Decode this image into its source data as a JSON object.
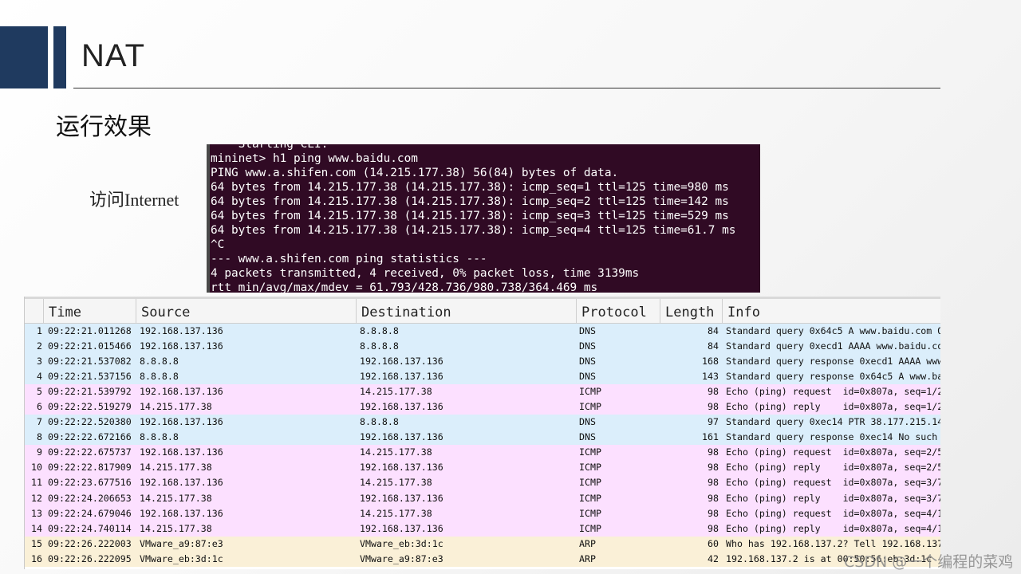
{
  "slide": {
    "title": "NAT",
    "subtitle": "运行效果",
    "side_label": "访问Internet"
  },
  "terminal": {
    "lines": [
      "*** Starting CLI:",
      "mininet> h1 ping www.baidu.com",
      "PING www.a.shifen.com (14.215.177.38) 56(84) bytes of data.",
      "64 bytes from 14.215.177.38 (14.215.177.38): icmp_seq=1 ttl=125 time=980 ms",
      "64 bytes from 14.215.177.38 (14.215.177.38): icmp_seq=2 ttl=125 time=142 ms",
      "64 bytes from 14.215.177.38 (14.215.177.38): icmp_seq=3 ttl=125 time=529 ms",
      "64 bytes from 14.215.177.38 (14.215.177.38): icmp_seq=4 ttl=125 time=61.7 ms",
      "^C",
      "--- www.a.shifen.com ping statistics ---",
      "4 packets transmitted, 4 received, 0% packet loss, time 3139ms",
      "rtt min/avg/max/mdev = 61.793/428.736/980.738/364.469 ms"
    ]
  },
  "packets": {
    "columns": [
      "Time",
      "Source",
      "Destination",
      "Protocol",
      "Length",
      "Info"
    ],
    "row_colors": {
      "DNS": "#dbeefb",
      "ICMP": "#fce0ff",
      "ARP": "#faf0d7"
    },
    "rows": [
      {
        "no": "1",
        "time": "09:22:21.011268",
        "src": "192.168.137.136",
        "dst": "8.8.8.8",
        "proto": "DNS",
        "len": "84",
        "info": "Standard query 0x64c5 A www.baidu.com O"
      },
      {
        "no": "2",
        "time": "09:22:21.015466",
        "src": "192.168.137.136",
        "dst": "8.8.8.8",
        "proto": "DNS",
        "len": "84",
        "info": "Standard query 0xecd1 AAAA www.baidu.co"
      },
      {
        "no": "3",
        "time": "09:22:21.537082",
        "src": "8.8.8.8",
        "dst": "192.168.137.136",
        "proto": "DNS",
        "len": "168",
        "info": "Standard query response 0xecd1 AAAA www"
      },
      {
        "no": "4",
        "time": "09:22:21.537156",
        "src": "8.8.8.8",
        "dst": "192.168.137.136",
        "proto": "DNS",
        "len": "143",
        "info": "Standard query response 0x64c5 A www.ba"
      },
      {
        "no": "5",
        "time": "09:22:21.539792",
        "src": "192.168.137.136",
        "dst": "14.215.177.38",
        "proto": "ICMP",
        "len": "98",
        "info": "Echo (ping) request  id=0x807a, seq=1/2"
      },
      {
        "no": "6",
        "time": "09:22:22.519279",
        "src": "14.215.177.38",
        "dst": "192.168.137.136",
        "proto": "ICMP",
        "len": "98",
        "info": "Echo (ping) reply    id=0x807a, seq=1/2"
      },
      {
        "no": "7",
        "time": "09:22:22.520380",
        "src": "192.168.137.136",
        "dst": "8.8.8.8",
        "proto": "DNS",
        "len": "97",
        "info": "Standard query 0xec14 PTR 38.177.215.14"
      },
      {
        "no": "8",
        "time": "09:22:22.672166",
        "src": "8.8.8.8",
        "dst": "192.168.137.136",
        "proto": "DNS",
        "len": "161",
        "info": "Standard query response 0xec14 No such"
      },
      {
        "no": "9",
        "time": "09:22:22.675737",
        "src": "192.168.137.136",
        "dst": "14.215.177.38",
        "proto": "ICMP",
        "len": "98",
        "info": "Echo (ping) request  id=0x807a, seq=2/5"
      },
      {
        "no": "10",
        "time": "09:22:22.817909",
        "src": "14.215.177.38",
        "dst": "192.168.137.136",
        "proto": "ICMP",
        "len": "98",
        "info": "Echo (ping) reply    id=0x807a, seq=2/5"
      },
      {
        "no": "11",
        "time": "09:22:23.677516",
        "src": "192.168.137.136",
        "dst": "14.215.177.38",
        "proto": "ICMP",
        "len": "98",
        "info": "Echo (ping) request  id=0x807a, seq=3/7"
      },
      {
        "no": "12",
        "time": "09:22:24.206653",
        "src": "14.215.177.38",
        "dst": "192.168.137.136",
        "proto": "ICMP",
        "len": "98",
        "info": "Echo (ping) reply    id=0x807a, seq=3/7"
      },
      {
        "no": "13",
        "time": "09:22:24.679046",
        "src": "192.168.137.136",
        "dst": "14.215.177.38",
        "proto": "ICMP",
        "len": "98",
        "info": "Echo (ping) request  id=0x807a, seq=4/1"
      },
      {
        "no": "14",
        "time": "09:22:24.740114",
        "src": "14.215.177.38",
        "dst": "192.168.137.136",
        "proto": "ICMP",
        "len": "98",
        "info": "Echo (ping) reply    id=0x807a, seq=4/1"
      },
      {
        "no": "15",
        "time": "09:22:26.222003",
        "src": "VMware_a9:87:e3",
        "dst": "VMware_eb:3d:1c",
        "proto": "ARP",
        "len": "60",
        "info": "Who has 192.168.137.2? Tell 192.168.137"
      },
      {
        "no": "16",
        "time": "09:22:26.222095",
        "src": "VMware_eb:3d:1c",
        "dst": "VMware_a9:87:e3",
        "proto": "ARP",
        "len": "42",
        "info": "192.168.137.2 is at 00:50:56:eb:3d:1c"
      }
    ]
  },
  "watermark": "CSDN @一个编程的菜鸡"
}
